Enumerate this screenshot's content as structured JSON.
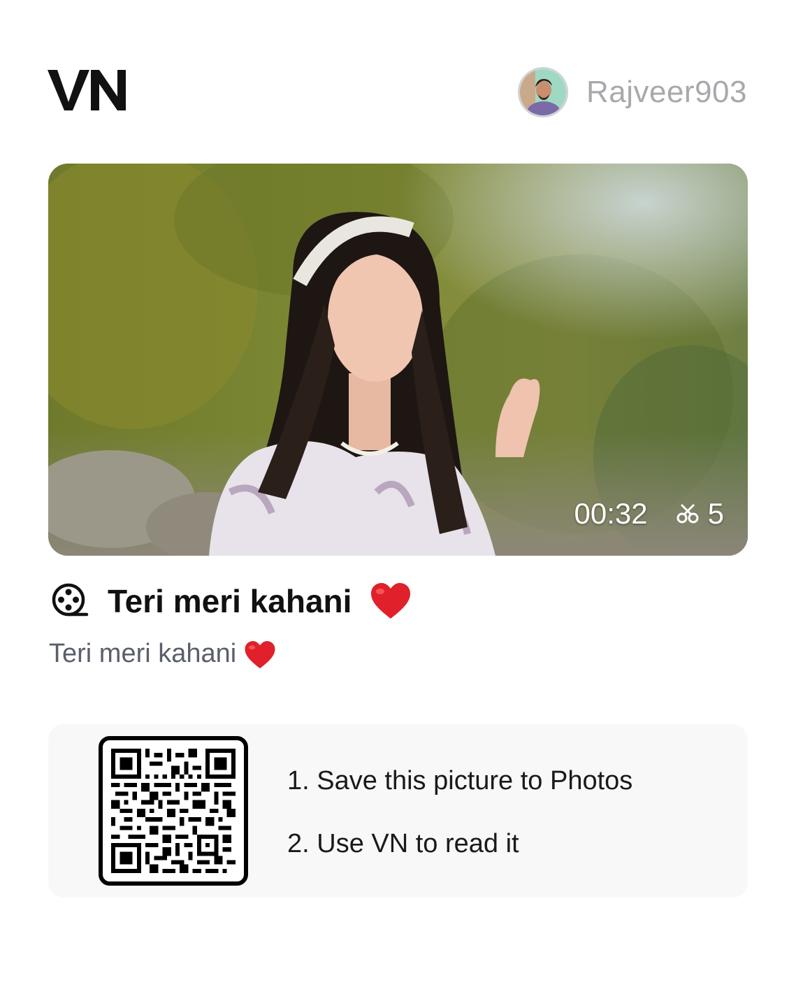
{
  "header": {
    "logo_text": "VN",
    "username": "Rajveer903"
  },
  "video": {
    "duration": "00:32",
    "clip_count": "5"
  },
  "project": {
    "title": "Teri meri kahani",
    "description": "Teri meri kahani"
  },
  "qr_panel": {
    "step1": "1. Save this picture to Photos",
    "step2": "2. Use VN to read it"
  },
  "icons": {
    "logo": "vn-logo-icon",
    "avatar": "avatar",
    "clips": "scissors-icon",
    "project": "film-reel-icon",
    "heart": "red-heart-emoji"
  },
  "colors": {
    "username": "#a7a9ac",
    "description": "#5a5f6a",
    "panel_bg": "#f8f8f8",
    "heart": "#e0202a"
  }
}
